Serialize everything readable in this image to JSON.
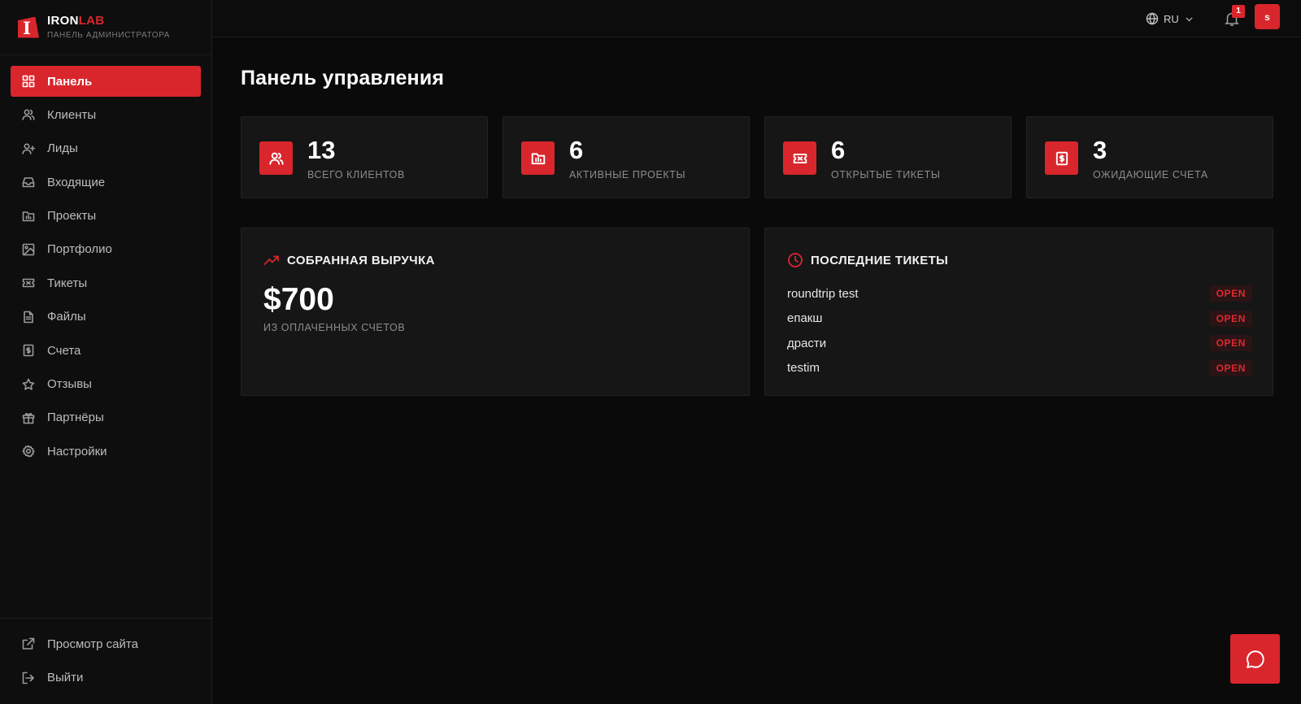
{
  "brand": {
    "name_part1": "IRON",
    "name_part2": "LAB",
    "subtitle": "ПАНЕЛЬ АДМИНИСТРАТОРА"
  },
  "sidebar": {
    "items": [
      {
        "label": "Панель",
        "icon": "grid-icon",
        "active": true
      },
      {
        "label": "Клиенты",
        "icon": "users-icon"
      },
      {
        "label": "Лиды",
        "icon": "user-plus-icon"
      },
      {
        "label": "Входящие",
        "icon": "inbox-icon"
      },
      {
        "label": "Проекты",
        "icon": "folder-icon"
      },
      {
        "label": "Портфолио",
        "icon": "image-icon"
      },
      {
        "label": "Тикеты",
        "icon": "ticket-icon"
      },
      {
        "label": "Файлы",
        "icon": "file-icon"
      },
      {
        "label": "Счета",
        "icon": "invoice-icon"
      },
      {
        "label": "Отзывы",
        "icon": "star-icon"
      },
      {
        "label": "Партнёры",
        "icon": "gift-icon"
      },
      {
        "label": "Настройки",
        "icon": "gear-icon"
      }
    ],
    "bottom": [
      {
        "label": "Просмотр сайта",
        "icon": "external-link-icon"
      },
      {
        "label": "Выйти",
        "icon": "logout-icon"
      }
    ]
  },
  "topbar": {
    "language": "RU",
    "notifications_count": "1",
    "avatar_initial": "s"
  },
  "page": {
    "title": "Панель управления"
  },
  "stats": [
    {
      "value": "13",
      "label": "ВСЕГО КЛИЕНТОВ",
      "icon": "users-icon"
    },
    {
      "value": "6",
      "label": "АКТИВНЫЕ ПРОЕКТЫ",
      "icon": "folder-icon"
    },
    {
      "value": "6",
      "label": "ОТКРЫТЫЕ ТИКЕТЫ",
      "icon": "ticket-icon"
    },
    {
      "value": "3",
      "label": "ОЖИДАЮЩИЕ СЧЕТА",
      "icon": "invoice-icon"
    }
  ],
  "revenue": {
    "title": "СОБРАННАЯ ВЫРУЧКА",
    "value": "$700",
    "subtitle": "ИЗ ОПЛАЧЕННЫХ СЧЕТОВ"
  },
  "recent_tickets": {
    "title": "ПОСЛЕДНИЕ ТИКЕТЫ",
    "items": [
      {
        "name": "roundtrip test",
        "status": "OPEN"
      },
      {
        "name": "епакш",
        "status": "OPEN"
      },
      {
        "name": "драсти",
        "status": "OPEN"
      },
      {
        "name": "testim",
        "status": "OPEN"
      }
    ]
  },
  "colors": {
    "accent": "#d9262c",
    "background": "#0a0a0a",
    "card": "#161616"
  }
}
